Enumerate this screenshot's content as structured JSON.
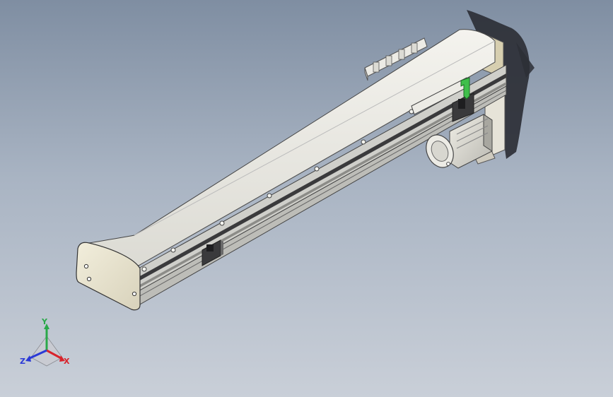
{
  "viewport": {
    "background_top": "#7f8ea2",
    "background_bottom": "#c9cfd8",
    "model": "linear-actuator-with-stepper-motor"
  },
  "triad": {
    "x_label": "X",
    "y_label": "Y",
    "z_label": "Z",
    "x_color": "#d8242c",
    "y_color": "#2aa84a",
    "z_color": "#2b3ad6"
  }
}
